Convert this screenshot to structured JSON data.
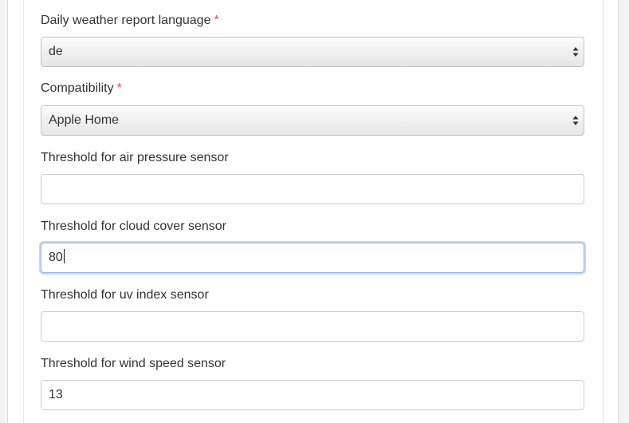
{
  "form": {
    "language": {
      "label": "Daily weather report language",
      "required_mark": "*",
      "value": "de"
    },
    "compatibility": {
      "label": "Compatibility",
      "required_mark": "*",
      "value": "Apple Home"
    },
    "air_pressure": {
      "label": "Threshold for air pressure sensor",
      "value": ""
    },
    "cloud_cover": {
      "label": "Threshold for cloud cover sensor",
      "value": "80"
    },
    "uv_index": {
      "label": "Threshold for uv index sensor",
      "value": ""
    },
    "wind_speed": {
      "label": "Threshold for wind speed sensor",
      "value": "13"
    }
  },
  "icons": {
    "select_arrows": "select-updown-arrows-icon"
  },
  "colors": {
    "required": "#d9534f",
    "focus_border": "#9ab6e8",
    "text": "#333333"
  }
}
